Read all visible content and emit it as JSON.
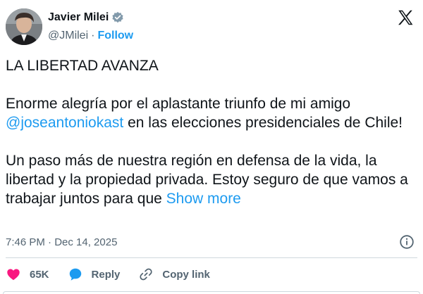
{
  "author": {
    "display_name": "Javier Milei",
    "handle": "@JMilei",
    "separator": "·",
    "follow_label": "Follow",
    "verified": true
  },
  "tweet": {
    "line1": "LA LIBERTAD AVANZA",
    "para2_before": "Enorme alegría por el aplastante triunfo de mi amigo",
    "mention": "@joseantoniokast",
    "para2_after": "en las elecciones presidenciales de Chile!",
    "para3": "Un paso más de nuestra región en defensa de la vida, la libertad y la propiedad privada. Estoy seguro de que vamos a trabajar juntos para que",
    "show_more": "Show more"
  },
  "meta": {
    "timestamp": "7:46 PM · Dec 14, 2025"
  },
  "actions": {
    "likes": "65K",
    "reply_label": "Reply",
    "copy_link_label": "Copy link"
  },
  "colors": {
    "accent": "#1d9bf0",
    "like": "#f91880",
    "text": "#0f1419",
    "secondary": "#536471",
    "border": "#cfd9de"
  },
  "icons": [
    "verified-badge-icon",
    "x-logo-icon",
    "info-icon",
    "heart-icon",
    "reply-bubble-icon",
    "link-icon"
  ]
}
